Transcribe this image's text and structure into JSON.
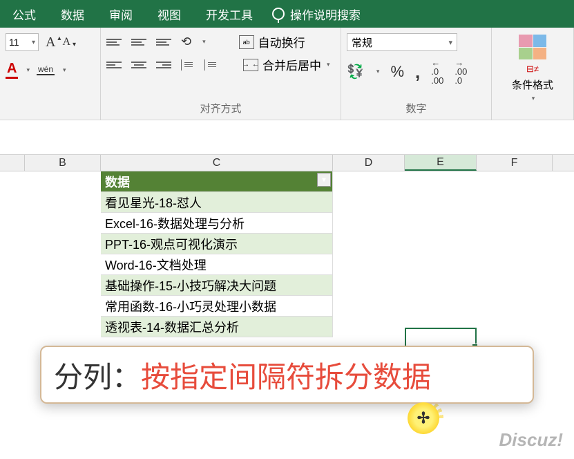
{
  "ribbon": {
    "tabs": [
      "公式",
      "数据",
      "审阅",
      "视图",
      "开发工具"
    ],
    "tellme": "操作说明搜索"
  },
  "font": {
    "size": "11",
    "wen": "wén"
  },
  "align": {
    "group_label": "对齐方式",
    "wrap": "自动换行",
    "wrap_icon": "ab",
    "merge": "合并后居中"
  },
  "number": {
    "group_label": "数字",
    "format": "常规",
    "dec_inc": ".0",
    "dec_inc2": ".00",
    "dec_dec": ".00",
    "dec_dec2": ".0"
  },
  "styles": {
    "condfmt": "条件格式"
  },
  "columns": {
    "A_width": 36,
    "B": "B",
    "B_width": 110,
    "C": "C",
    "C_width": 336,
    "D": "D",
    "D_width": 104,
    "E": "E",
    "E_width": 104,
    "F": "F",
    "F_width": 110
  },
  "table": {
    "header": "数据",
    "rows": [
      "看见星光-18-怼人",
      "Excel-16-数据处理与分析",
      "PPT-16-观点可视化演示",
      "Word-16-文档处理",
      "基础操作-15-小技巧解决大问题",
      "常用函数-16-小巧灵处理小数据",
      "透视表-14-数据汇总分析"
    ]
  },
  "callout": {
    "label": "分列：",
    "text": "按指定间隔符拆分数据"
  },
  "watermark": "Discuz!",
  "cursor_glyph": "✢"
}
